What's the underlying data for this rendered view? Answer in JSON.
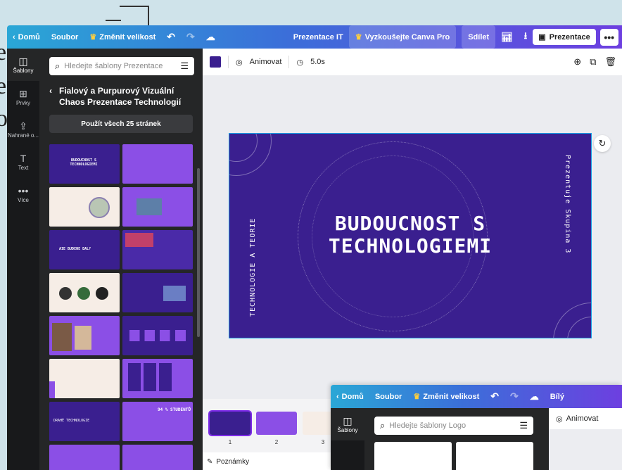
{
  "bg": {
    "letters": [
      "e",
      "e",
      "o"
    ]
  },
  "topbar": {
    "home": "Domů",
    "file": "Soubor",
    "resize": "Změnit velikost",
    "doc_title": "Prezentace IT",
    "try_pro": "Vyzkoušejte Canva Pro",
    "share": "Sdílet",
    "present": "Prezentace",
    "more": "•••"
  },
  "rail": [
    {
      "icon": "templates-icon",
      "glyph": "◫",
      "label": "Šablony"
    },
    {
      "icon": "elements-icon",
      "glyph": "⊞",
      "label": "Prvky"
    },
    {
      "icon": "uploads-icon",
      "glyph": "⇪",
      "label": "Nahrané o..."
    },
    {
      "icon": "text-icon",
      "glyph": "T",
      "label": "Text"
    },
    {
      "icon": "more-icon",
      "glyph": "•••",
      "label": "Více"
    }
  ],
  "panel": {
    "search_placeholder": "Hledejte šablony Prezentace",
    "template_title": "Fialový a Purpurový Vizuální Chaos Prezentace Technologií",
    "use_all": "Použít všech 25 stránek",
    "thumb_texts": {
      "t1": "BUDOUCNOST S TECHNOLOGIEMI",
      "t5": "AIE BUDENE DAL?",
      "t16": "94 % STUDENTŮ",
      "t15": "DRAHÉ TECHNOLOGIE"
    }
  },
  "toolbar": {
    "animate": "Animovat",
    "duration": "5.0s"
  },
  "slide": {
    "title_line1": "BUDOUCNOST S",
    "title_line2": "TECHNOLOGIEMI",
    "left_vertical": "TECHNOLOGIE A TEORIE",
    "right_vertical": "Prezentuje Skupina 3",
    "bg_color": "#3a1f8f"
  },
  "pages": {
    "numbers": [
      "1",
      "2",
      "3"
    ]
  },
  "notes": "Poznámky",
  "win2": {
    "home": "Domů",
    "file": "Soubor",
    "resize": "Změnit velikost",
    "extra": "Bílý",
    "search_placeholder": "Hledejte šablony Logo",
    "animate": "Animovat",
    "rail_label": "Šablony"
  }
}
